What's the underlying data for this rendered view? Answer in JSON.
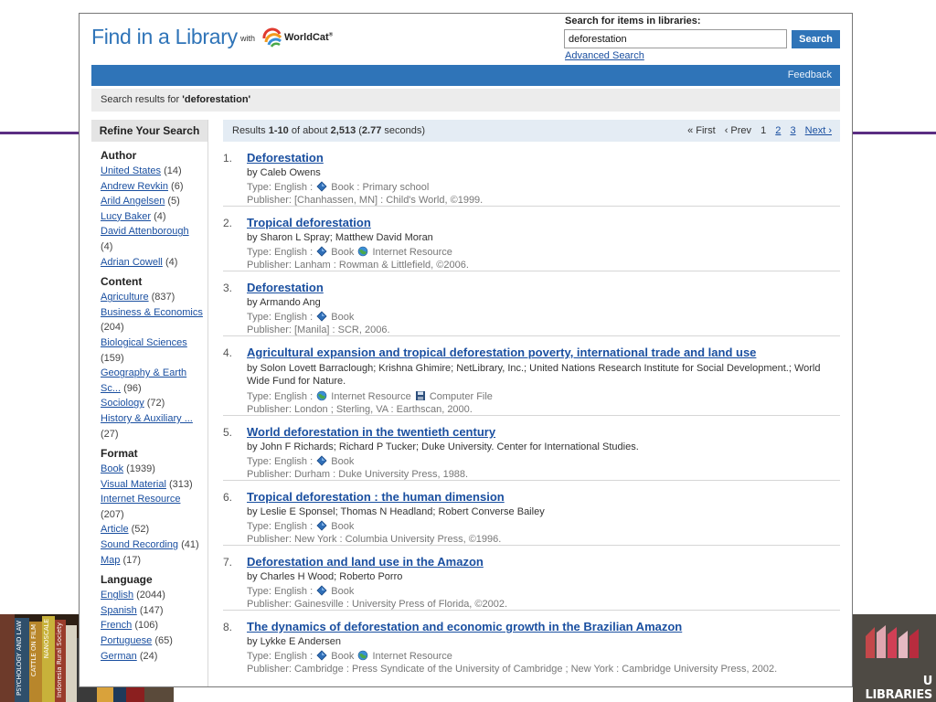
{
  "header": {
    "title": "Find in a Library",
    "with_text": "with",
    "brand": "WorldCat",
    "brand_mark": "®"
  },
  "search": {
    "label": "Search for items in libraries:",
    "value": "deforestation",
    "button": "Search",
    "advanced_link": "Advanced Search"
  },
  "bluebar": {
    "feedback": "Feedback"
  },
  "query_bar": {
    "prefix": "Search results for ",
    "query": "'deforestation'"
  },
  "refine": {
    "title": "Refine Your Search",
    "facets": [
      {
        "title": "Author",
        "items": [
          {
            "label": "United States",
            "count": "(14)"
          },
          {
            "label": "Andrew Revkin",
            "count": "(6)"
          },
          {
            "label": "Arild Angelsen",
            "count": "(5)"
          },
          {
            "label": "Lucy Baker",
            "count": "(4)"
          },
          {
            "label": "David Attenborough",
            "count": "(4)"
          },
          {
            "label": "Adrian Cowell",
            "count": "(4)"
          }
        ]
      },
      {
        "title": "Content",
        "items": [
          {
            "label": "Agriculture",
            "count": "(837)"
          },
          {
            "label": "Business & Economics",
            "count": "(204)"
          },
          {
            "label": "Biological Sciences",
            "count": "(159)"
          },
          {
            "label": "Geography & Earth Sc...",
            "count": "(96)"
          },
          {
            "label": "Sociology",
            "count": "(72)"
          },
          {
            "label": "History & Auxiliary ...",
            "count": "(27)"
          }
        ]
      },
      {
        "title": "Format",
        "items": [
          {
            "label": "Book",
            "count": "(1939)"
          },
          {
            "label": "Visual Material",
            "count": "(313)"
          },
          {
            "label": "Internet Resource",
            "count": "(207)"
          },
          {
            "label": "Article",
            "count": "(52)"
          },
          {
            "label": "Sound Recording",
            "count": "(41)"
          },
          {
            "label": "Map",
            "count": "(17)"
          }
        ]
      },
      {
        "title": "Language",
        "items": [
          {
            "label": "English",
            "count": "(2044)"
          },
          {
            "label": "Spanish",
            "count": "(147)"
          },
          {
            "label": "French",
            "count": "(106)"
          },
          {
            "label": "Portuguese",
            "count": "(65)"
          },
          {
            "label": "German",
            "count": "(24)"
          }
        ]
      }
    ]
  },
  "results_header": {
    "pre": "Results ",
    "range": "1-10",
    "mid": " of about ",
    "total": "2,513",
    "open": " (",
    "seconds": "2.77",
    "post": " seconds)"
  },
  "pager": {
    "first": "« First",
    "prev": "‹ Prev",
    "current": "1",
    "pages": [
      "2",
      "3"
    ],
    "next": "Next ›"
  },
  "results": [
    {
      "num": "1.",
      "title": "Deforestation",
      "author": "by Caleb Owens",
      "type": [
        {
          "t": "text",
          "v": "Type: English : "
        },
        {
          "t": "icon",
          "v": "book-icon"
        },
        {
          "t": "text",
          "v": " Book : Primary school"
        }
      ],
      "publisher": "Publisher: [Chanhassen, MN] : Child's World, ©1999."
    },
    {
      "num": "2.",
      "title": "Tropical deforestation",
      "author": "by Sharon L Spray; Matthew David Moran",
      "type": [
        {
          "t": "text",
          "v": "Type: English : "
        },
        {
          "t": "icon",
          "v": "book-icon"
        },
        {
          "t": "text",
          "v": " Book "
        },
        {
          "t": "icon",
          "v": "internet-resource-icon"
        },
        {
          "t": "text",
          "v": " Internet Resource"
        }
      ],
      "publisher": "Publisher: Lanham : Rowman & Littlefield, ©2006."
    },
    {
      "num": "3.",
      "title": "Deforestation",
      "author": "by Armando Ang",
      "type": [
        {
          "t": "text",
          "v": "Type: English : "
        },
        {
          "t": "icon",
          "v": "book-icon"
        },
        {
          "t": "text",
          "v": " Book"
        }
      ],
      "publisher": "Publisher: [Manila] : SCR, 2006."
    },
    {
      "num": "4.",
      "title": "Agricultural expansion and tropical deforestation poverty, international trade and land use",
      "tall": true,
      "author": "by Solon Lovett Barraclough; Krishna Ghimire; NetLibrary, Inc.; United Nations Research Institute for Social Development.; World Wide Fund for Nature.",
      "type": [
        {
          "t": "text",
          "v": "Type: English : "
        },
        {
          "t": "icon",
          "v": "internet-resource-icon"
        },
        {
          "t": "text",
          "v": " Internet Resource "
        },
        {
          "t": "icon",
          "v": "computer-file-icon"
        },
        {
          "t": "text",
          "v": " Computer File"
        }
      ],
      "publisher": "Publisher: London ; Sterling, VA : Earthscan, 2000."
    },
    {
      "num": "5.",
      "title": "World deforestation in the twentieth century",
      "author": "by John F Richards; Richard P Tucker; Duke University. Center for International Studies.",
      "type": [
        {
          "t": "text",
          "v": "Type: English : "
        },
        {
          "t": "icon",
          "v": "book-icon"
        },
        {
          "t": "text",
          "v": " Book"
        }
      ],
      "publisher": "Publisher: Durham : Duke University Press, 1988."
    },
    {
      "num": "6.",
      "title": "Tropical deforestation : the human dimension",
      "author": "by Leslie E Sponsel; Thomas N Headland; Robert Converse Bailey",
      "type": [
        {
          "t": "text",
          "v": "Type: English : "
        },
        {
          "t": "icon",
          "v": "book-icon"
        },
        {
          "t": "text",
          "v": " Book"
        }
      ],
      "publisher": "Publisher: New York : Columbia University Press, ©1996."
    },
    {
      "num": "7.",
      "title": "Deforestation and land use in the Amazon",
      "author": "by Charles H Wood; Roberto Porro",
      "type": [
        {
          "t": "text",
          "v": "Type: English : "
        },
        {
          "t": "icon",
          "v": "book-icon"
        },
        {
          "t": "text",
          "v": " Book"
        }
      ],
      "publisher": "Publisher: Gainesville : University Press of Florida, ©2002."
    },
    {
      "num": "8.",
      "title": "The dynamics of deforestation and economic growth in the Brazilian Amazon",
      "author": "by Lykke E Andersen",
      "last": true,
      "type": [
        {
          "t": "text",
          "v": "Type: English : "
        },
        {
          "t": "icon",
          "v": "book-icon"
        },
        {
          "t": "text",
          "v": " Book "
        },
        {
          "t": "icon",
          "v": "internet-resource-icon"
        },
        {
          "t": "text",
          "v": " Internet Resource"
        }
      ],
      "publisher": "Publisher: Cambridge : Press Syndicate of the University of Cambridge ; New York : Cambridge University Press, 2002."
    }
  ],
  "slide": {
    "logo_text": "U LIBRARIES",
    "books": [
      "PSYCHOLOGY AND LAW",
      "CATTLE ON FILM",
      "NANOSCALE",
      "Indonesia Rural Society"
    ]
  },
  "colors": {
    "accent": "#2f74b8",
    "link": "#1a4fa0",
    "slide_line": "#5b2d82"
  }
}
